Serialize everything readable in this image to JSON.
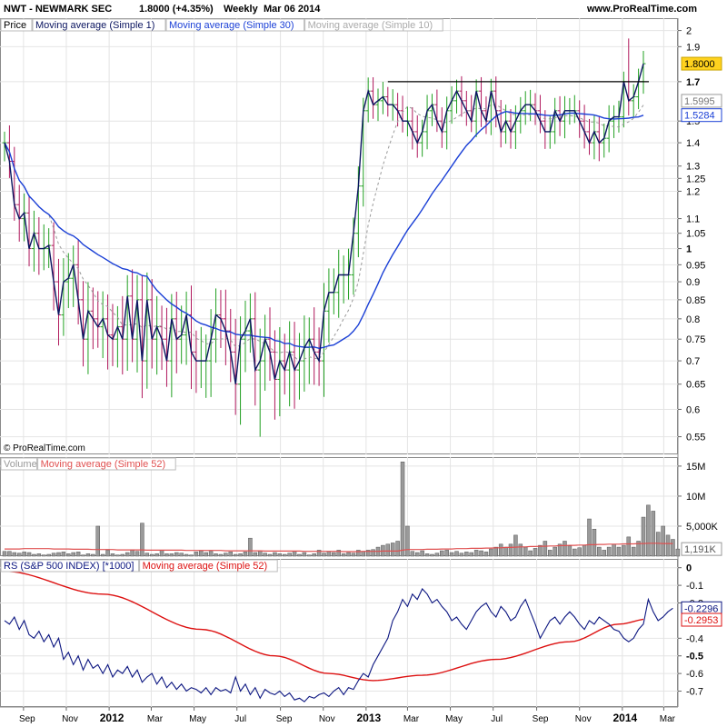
{
  "header": {
    "symbol": "NWT - NEWMARK SEC",
    "last": "1.8000 (+4.35%)",
    "period": "Weekly",
    "date": "Mar 06 2014",
    "site": "www.ProRealTime.com"
  },
  "copyright": "© ProRealTime.com",
  "colors": {
    "up": "#22a022",
    "down": "#b0185c",
    "close_line": "#0b1560",
    "ma_price30": "#1a3fd6",
    "ma_price10": "#999999",
    "volume_bar": "#9a9a9a",
    "volume_ma": "#e05050",
    "rs_line": "#0b1580",
    "rs_ma": "#dd1111",
    "grid": "#e4e4e4",
    "last_price_box": "#ffd21e"
  },
  "chart_data": [
    {
      "type": "line",
      "panel": "price",
      "legend": [
        "Price",
        "Moving average (Simple 1)",
        "Moving average (Simple 30)",
        "Moving average (Simple 10)"
      ],
      "y_scale": "log",
      "ylim": [
        0.52,
        2.08
      ],
      "y_ticks": [
        "2",
        "1.9",
        "1.7",
        "1.5",
        "1.4",
        "1.3",
        "1.25",
        "1.2",
        "1.1",
        "1.05",
        "1",
        "0.95",
        "0.9",
        "0.85",
        "0.8",
        "0.75",
        "0.7",
        "0.65",
        "0.6",
        "0.55"
      ],
      "bold_ticks": [
        "1.7",
        "1"
      ],
      "x_ticks": [
        "Sep",
        "Nov",
        "2012",
        "Mar",
        "May",
        "Jul",
        "Sep",
        "Nov",
        "2013",
        "Mar",
        "May",
        "Jul",
        "Sep",
        "Nov",
        "2014",
        "Mar"
      ],
      "bold_x_ticks": [
        "2012",
        "2013",
        "2014"
      ],
      "x_start": "2011-08-05",
      "x_step_weeks": 1,
      "close": [
        1.4,
        1.32,
        1.15,
        1.1,
        1.12,
        1.0,
        1.05,
        1.0,
        1.0,
        1.01,
        0.9,
        0.81,
        0.9,
        0.91,
        0.95,
        0.85,
        0.75,
        0.82,
        0.8,
        0.78,
        0.8,
        0.76,
        0.75,
        0.78,
        0.75,
        0.86,
        0.75,
        0.85,
        0.7,
        0.85,
        0.75,
        0.78,
        0.75,
        0.7,
        0.8,
        0.75,
        0.76,
        0.81,
        0.72,
        0.7,
        0.7,
        0.7,
        0.75,
        0.81,
        0.8,
        0.77,
        0.72,
        0.65,
        0.75,
        0.77,
        0.8,
        0.68,
        0.7,
        0.75,
        0.72,
        0.66,
        0.7,
        0.68,
        0.72,
        0.68,
        0.7,
        0.73,
        0.75,
        0.72,
        0.7,
        0.82,
        0.87,
        0.87,
        0.92,
        0.92,
        0.92,
        1.05,
        1.22,
        1.55,
        1.65,
        1.58,
        1.6,
        1.62,
        1.58,
        1.58,
        1.55,
        1.5,
        1.5,
        1.45,
        1.4,
        1.45,
        1.55,
        1.58,
        1.5,
        1.45,
        1.55,
        1.6,
        1.65,
        1.6,
        1.55,
        1.5,
        1.65,
        1.55,
        1.5,
        1.65,
        1.55,
        1.45,
        1.5,
        1.45,
        1.5,
        1.55,
        1.58,
        1.58,
        1.55,
        1.5,
        1.45,
        1.45,
        1.55,
        1.5,
        1.55,
        1.55,
        1.55,
        1.5,
        1.45,
        1.4,
        1.45,
        1.4,
        1.42,
        1.5,
        1.52,
        1.52,
        1.7,
        1.6,
        1.62,
        1.7,
        1.8
      ],
      "high_override": {
        "127": 1.95
      },
      "low_override": {
        "52": 0.55
      },
      "resistance": 1.7,
      "last_labels": [
        {
          "text": "1.8000",
          "value": 1.8,
          "style": "highlight"
        },
        {
          "text": "1.5995",
          "value": 1.5995,
          "style": "grey"
        },
        {
          "text": "1.5284",
          "value": 1.5284,
          "style": "blue"
        }
      ]
    },
    {
      "type": "bar",
      "panel": "volume",
      "legend": [
        "Volume",
        "Moving average (Simple 52)"
      ],
      "ylim": [
        0,
        16500000
      ],
      "y_ticks": [
        {
          "label": "15M",
          "value": 15000000
        },
        {
          "label": "10M",
          "value": 10000000
        },
        {
          "label": "5,000K",
          "value": 5000000
        }
      ],
      "last_label": "1,191K",
      "values": [
        800000,
        800000,
        600000,
        500000,
        700000,
        600000,
        300000,
        400000,
        200000,
        300000,
        500000,
        600000,
        700000,
        400000,
        600000,
        700000,
        200000,
        400000,
        300000,
        5000000,
        300000,
        1000000,
        400000,
        200000,
        300000,
        600000,
        1000000,
        800000,
        5500000,
        500000,
        300000,
        400000,
        1000000,
        400000,
        400000,
        600000,
        500000,
        300000,
        200000,
        700000,
        900000,
        600000,
        800000,
        400000,
        300000,
        500000,
        700000,
        300000,
        400000,
        700000,
        3000000,
        600000,
        900000,
        500000,
        300000,
        600000,
        400000,
        300000,
        500000,
        800000,
        300000,
        600000,
        200000,
        400000,
        1000000,
        500000,
        800000,
        600000,
        1000000,
        400000,
        600000,
        500000,
        1000000,
        800000,
        1000000,
        1100000,
        1500000,
        1800000,
        2000000,
        2200000,
        2500000,
        15700000,
        5000000,
        800000,
        600000,
        900000,
        400000,
        300000,
        500000,
        900000,
        1000000,
        600000,
        800000,
        500000,
        700000,
        600000,
        1000000,
        900000,
        700000,
        1200000,
        1500000,
        2000000,
        1500000,
        2000000,
        3500000,
        2000000,
        1500000,
        900000,
        1300000,
        1800000,
        2500000,
        1000000,
        1500000,
        2000000,
        2500000,
        1700000,
        1200000,
        1400000,
        1800000,
        6200000,
        4500000,
        1500000,
        1000000,
        1500000,
        2000000,
        1500000,
        1800000,
        3200000,
        1500000,
        2500000,
        6500000,
        8500000,
        7500000,
        4000000,
        5000000,
        3500000,
        2800000,
        1191000
      ],
      "ma_values": [
        1200000,
        1200000,
        1200000,
        1200000,
        1250000,
        1250000,
        1250000,
        1250000,
        1250000,
        1250000,
        1200000,
        1200000,
        1200000,
        1200000,
        1150000,
        1150000,
        1150000,
        1150000,
        1100000,
        1100000,
        1100000,
        1100000,
        1100000,
        1050000,
        1050000,
        1050000,
        1050000,
        1050000,
        1050000,
        1000000,
        1000000,
        1000000,
        1000000,
        1000000,
        1000000,
        1000000,
        1000000,
        950000,
        950000,
        950000,
        950000,
        950000,
        950000,
        950000,
        950000,
        900000,
        900000,
        900000,
        900000,
        900000,
        900000,
        900000,
        900000,
        850000,
        850000,
        850000,
        850000,
        850000,
        850000,
        850000,
        850000,
        800000,
        800000,
        800000,
        800000,
        800000,
        800000,
        800000,
        800000,
        750000,
        750000,
        750000,
        750000,
        800000,
        800000,
        800000,
        800000,
        850000,
        850000,
        850000,
        850000,
        1000000,
        1100000,
        1100000,
        1100000,
        1100000,
        1150000,
        1150000,
        1150000,
        1200000,
        1200000,
        1200000,
        1250000,
        1250000,
        1250000,
        1300000,
        1300000,
        1300000,
        1350000,
        1350000,
        1400000,
        1400000,
        1450000,
        1450000,
        1500000,
        1550000,
        1550000,
        1600000,
        1600000,
        1650000,
        1650000,
        1700000,
        1700000,
        1750000,
        1750000,
        1800000,
        1800000,
        1850000,
        1850000,
        1900000,
        1900000,
        1950000,
        1950000,
        2000000,
        2000000,
        2000000,
        2050000,
        2050000,
        2050000,
        2100000,
        2100000,
        2150000,
        2150000,
        2150000,
        2100000,
        2100000,
        2100000
      ]
    },
    {
      "type": "line",
      "panel": "relative_strength",
      "legend": [
        "RS (S&P 500 INDEX) [*1000]",
        "Moving average (Simple 52)"
      ],
      "ylim": [
        -0.79,
        0.05
      ],
      "y_ticks": [
        "0",
        "-0.1",
        "-0.2",
        "-0.4",
        "-0.5",
        "-0.6",
        "-0.7"
      ],
      "bold_ticks": [
        "0",
        "-0.5"
      ],
      "last_labels": [
        {
          "text": "-0.2296",
          "value": -0.2296,
          "style": "blue"
        },
        {
          "text": "-0.2953",
          "value": -0.2953,
          "style": "red"
        }
      ],
      "rs_values": [
        -0.3,
        -0.32,
        -0.28,
        -0.35,
        -0.3,
        -0.38,
        -0.4,
        -0.36,
        -0.42,
        -0.38,
        -0.45,
        -0.4,
        -0.52,
        -0.48,
        -0.55,
        -0.5,
        -0.58,
        -0.52,
        -0.57,
        -0.55,
        -0.6,
        -0.55,
        -0.62,
        -0.58,
        -0.6,
        -0.56,
        -0.62,
        -0.58,
        -0.65,
        -0.62,
        -0.6,
        -0.66,
        -0.62,
        -0.68,
        -0.65,
        -0.69,
        -0.66,
        -0.7,
        -0.68,
        -0.69,
        -0.71,
        -0.68,
        -0.72,
        -0.68,
        -0.7,
        -0.69,
        -0.71,
        -0.62,
        -0.7,
        -0.66,
        -0.72,
        -0.68,
        -0.74,
        -0.69,
        -0.71,
        -0.72,
        -0.7,
        -0.73,
        -0.71,
        -0.75,
        -0.74,
        -0.76,
        -0.73,
        -0.74,
        -0.72,
        -0.71,
        -0.73,
        -0.7,
        -0.68,
        -0.72,
        -0.68,
        -0.69,
        -0.64,
        -0.6,
        -0.62,
        -0.55,
        -0.5,
        -0.45,
        -0.4,
        -0.3,
        -0.25,
        -0.18,
        -0.22,
        -0.15,
        -0.18,
        -0.12,
        -0.15,
        -0.2,
        -0.18,
        -0.22,
        -0.25,
        -0.3,
        -0.28,
        -0.32,
        -0.35,
        -0.3,
        -0.25,
        -0.22,
        -0.2,
        -0.25,
        -0.28,
        -0.22,
        -0.25,
        -0.3,
        -0.28,
        -0.22,
        -0.18,
        -0.25,
        -0.32,
        -0.4,
        -0.35,
        -0.3,
        -0.28,
        -0.32,
        -0.28,
        -0.25,
        -0.28,
        -0.32,
        -0.35,
        -0.3,
        -0.32,
        -0.28,
        -0.3,
        -0.32,
        -0.35,
        -0.36,
        -0.4,
        -0.42,
        -0.4,
        -0.35,
        -0.32,
        -0.18,
        -0.25,
        -0.3,
        -0.28,
        -0.25,
        -0.23
      ],
      "ma_anchors": [
        [
          0,
          -0.02
        ],
        [
          20,
          -0.15
        ],
        [
          40,
          -0.35
        ],
        [
          55,
          -0.5
        ],
        [
          66,
          -0.6
        ],
        [
          75,
          -0.64
        ],
        [
          85,
          -0.61
        ],
        [
          100,
          -0.52
        ],
        [
          115,
          -0.42
        ],
        [
          125,
          -0.32
        ],
        [
          131,
          -0.29
        ],
        [
          136,
          -0.3
        ]
      ]
    }
  ]
}
